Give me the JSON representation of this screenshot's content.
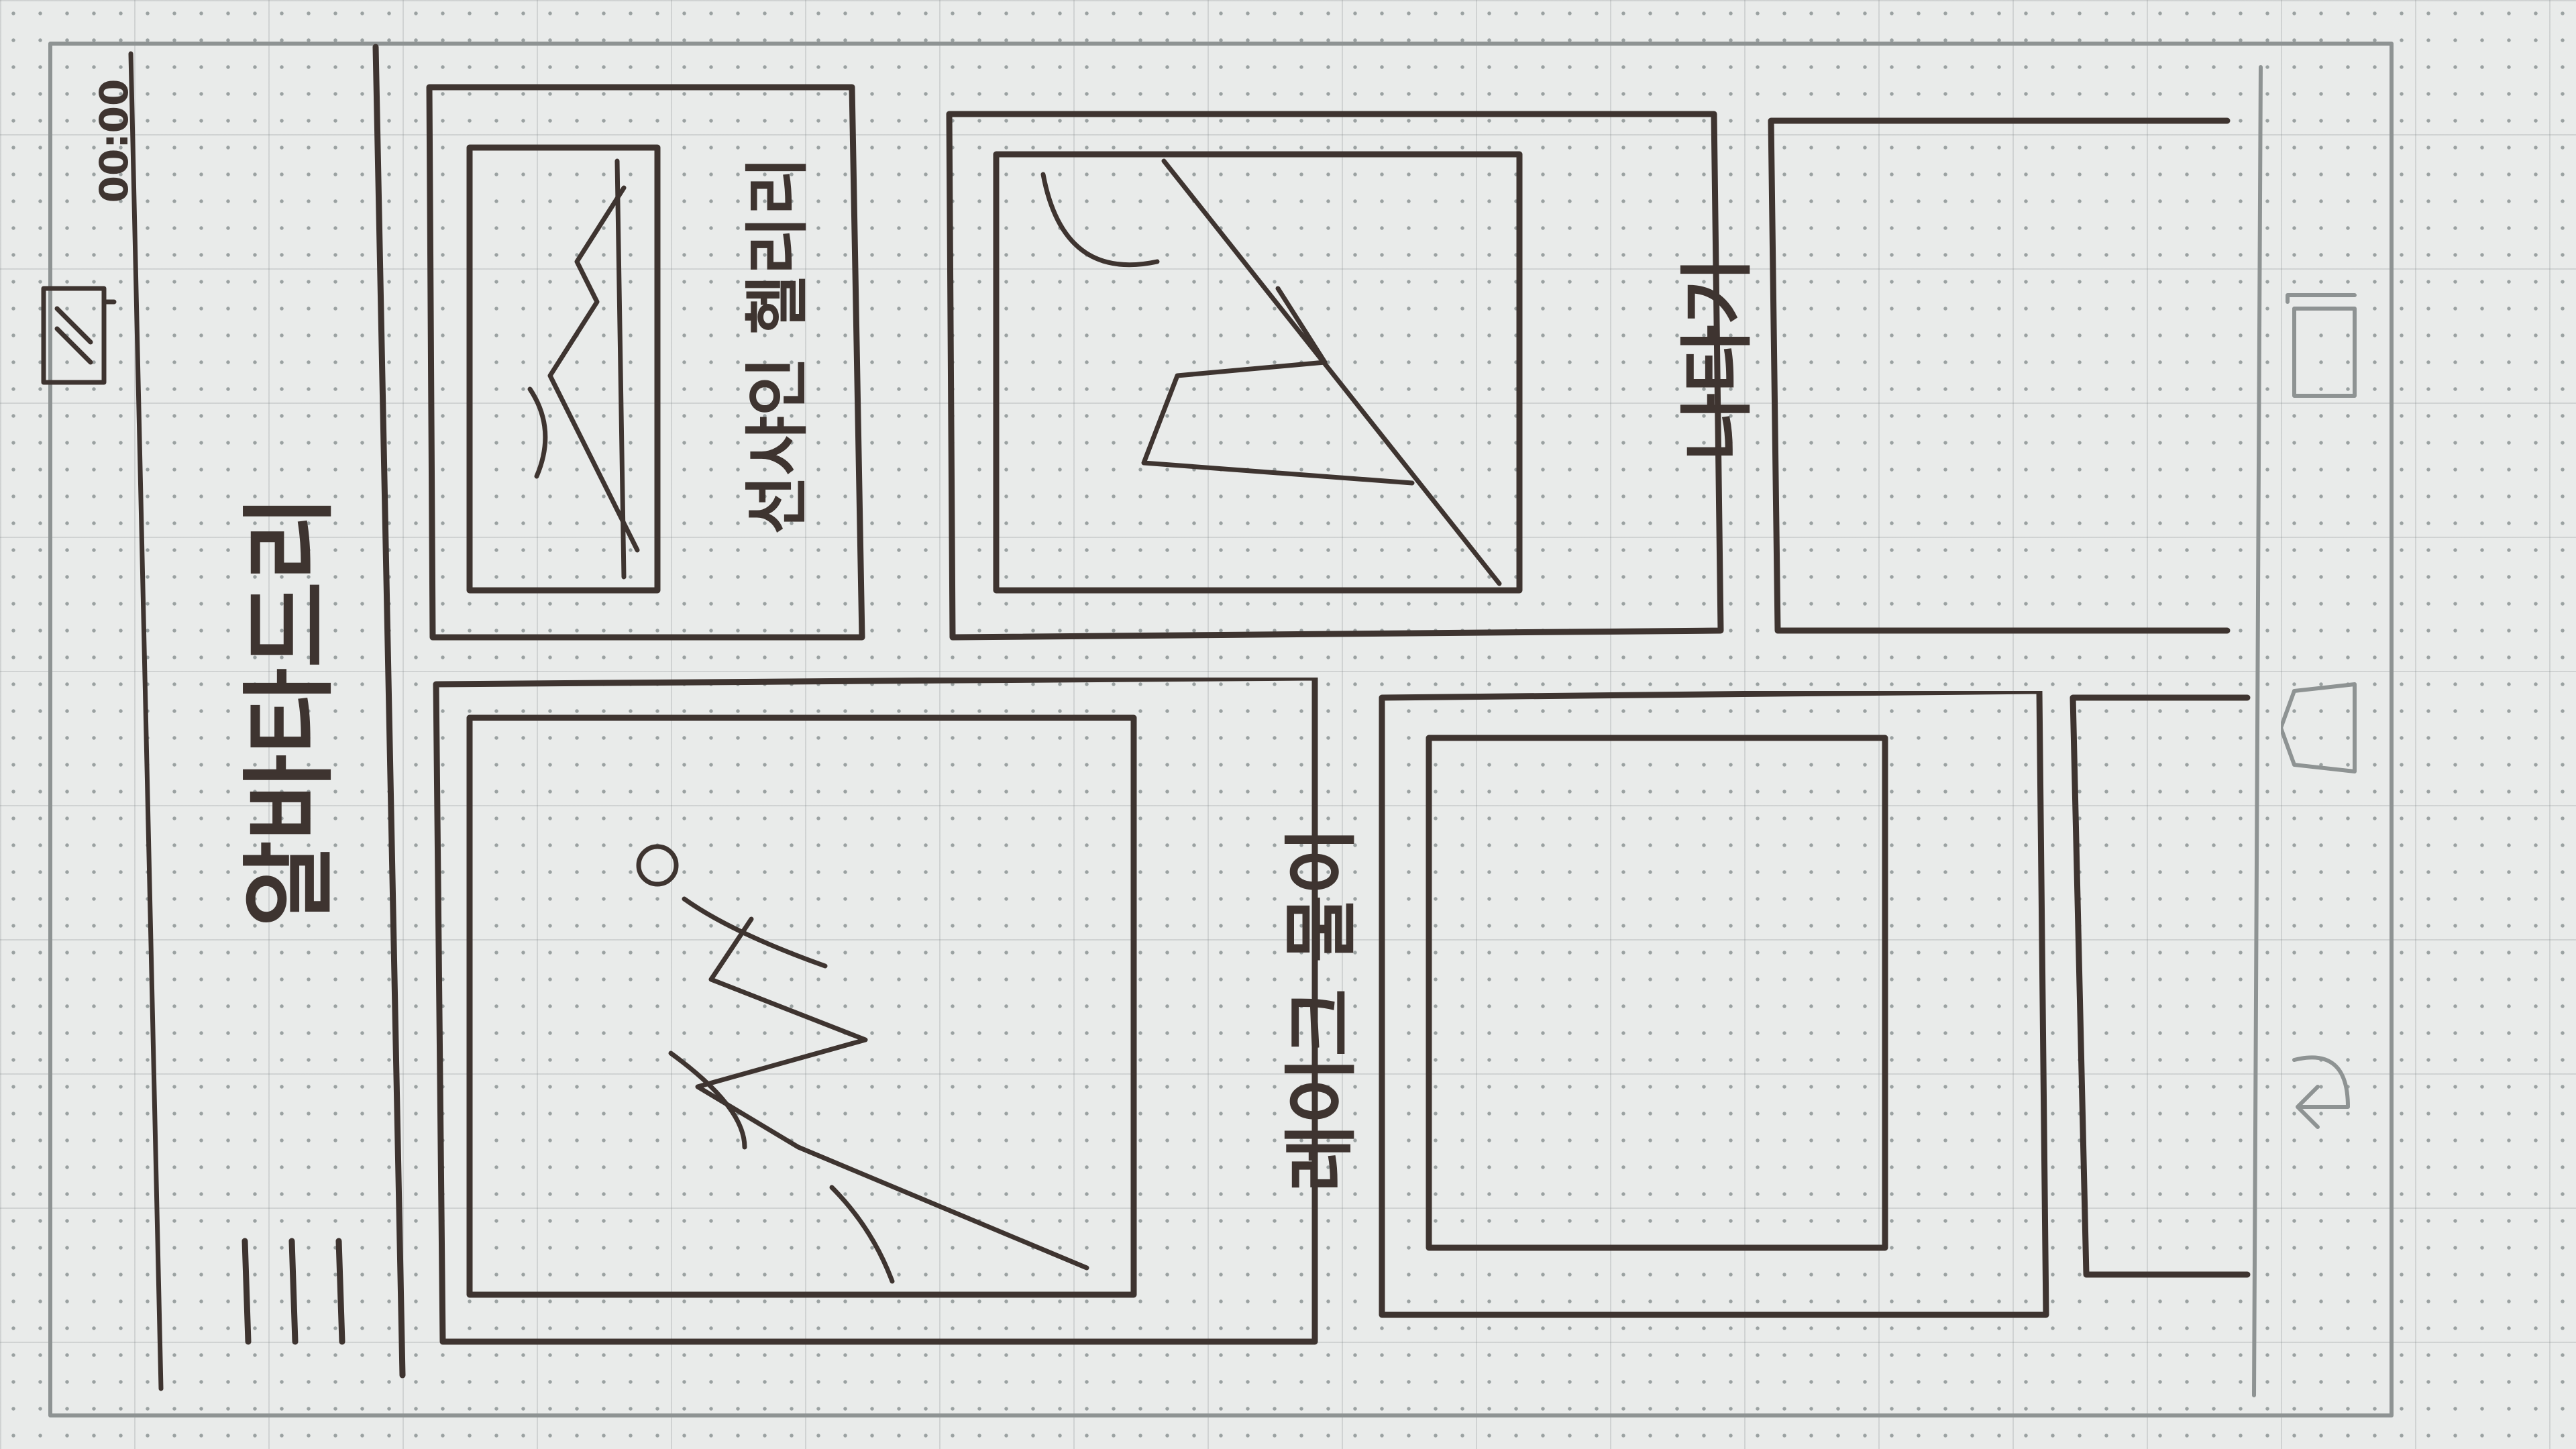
{
  "status_bar": {
    "time": "00:00"
  },
  "app_bar": {
    "title": "알바타드리",
    "menu_icon": "hamburger-menu-icon"
  },
  "cards": [
    {
      "label": "선샤인 헬리리",
      "icon": "image-placeholder-icon"
    },
    {
      "label": "레이크 물이",
      "icon": "image-placeholder-icon"
    },
    {
      "label": "나타기",
      "icon": "image-placeholder-icon"
    },
    {
      "label": "",
      "icon": "image-placeholder-icon"
    },
    {
      "label": ""
    },
    {
      "label": ""
    }
  ],
  "nav_bar": {
    "back_icon": "back-icon",
    "home_icon": "home-icon",
    "recents_icon": "recents-icon"
  },
  "colors": {
    "ink": "#3e3430",
    "paper": "#e9ebea",
    "grid_dot": "#9aa1a1"
  }
}
